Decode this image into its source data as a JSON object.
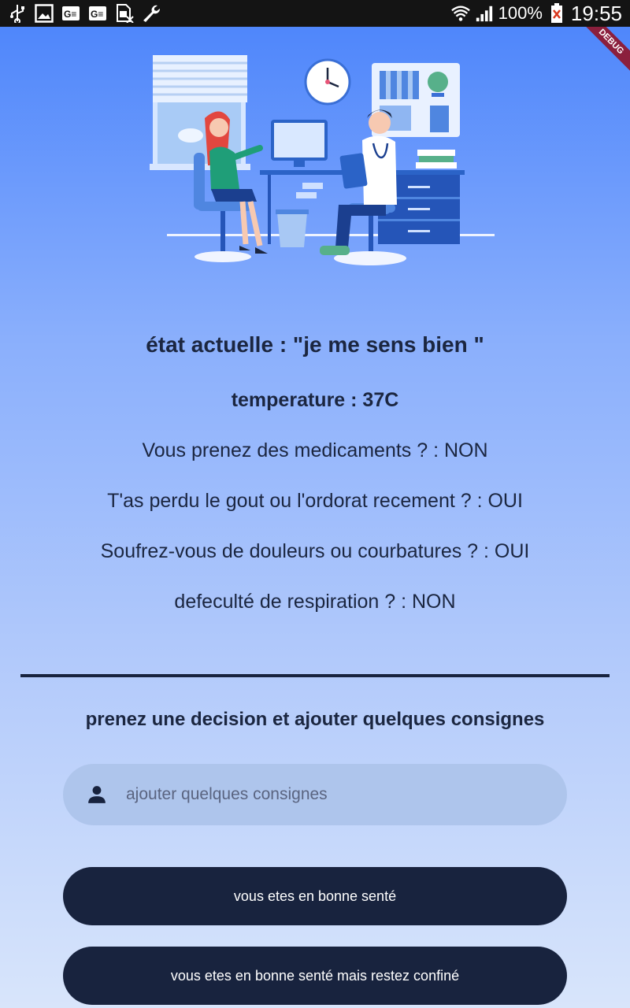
{
  "status_bar": {
    "battery": "100%",
    "time": "19:55",
    "left_icons": [
      "usb-icon",
      "image-icon",
      "ge-icon",
      "ge-icon",
      "sim-x-icon",
      "wrench-icon"
    ],
    "right_icons": [
      "wifi-icon",
      "signal-icon",
      "battery-alert-icon"
    ]
  },
  "debug_banner": "DEBUG",
  "patient_info": {
    "state": "état actuelle : \"je me sens bien  \"",
    "temperature": "temperature : 37C",
    "questions": [
      "Vous prenez des medicaments ? : NON",
      "T'as perdu le gout ou l'ordorat recement ? : OUI",
      "Soufrez-vous de douleurs ou courbatures ? : OUI",
      "defeculté de respiration  ? : NON"
    ]
  },
  "decision": {
    "title": "prenez une decision et ajouter quelques consignes",
    "input_placeholder": "ajouter quelques consignes",
    "input_value": ""
  },
  "buttons": {
    "healthy": "vous etes en bonne senté",
    "healthy_confined": "vous etes en bonne senté mais restez confiné"
  },
  "colors": {
    "primary_dark": "#18233e",
    "gradient_top": "#4a83fb",
    "gradient_bottom": "#d8e5fb",
    "input_bg": "#aec5ec"
  }
}
